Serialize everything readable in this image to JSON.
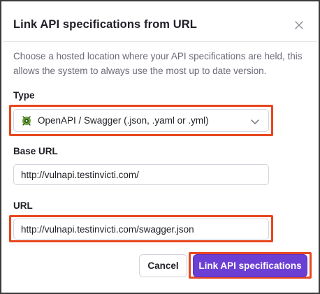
{
  "dialog": {
    "title": "Link API specifications from URL",
    "description": "Choose a hosted location where your API specifications are held, this allows the system to always use the most up to date version."
  },
  "type_field": {
    "label": "Type",
    "selected": "OpenAPI / Swagger (.json, .yaml or .yml)",
    "icon": "swagger-icon"
  },
  "base_url_field": {
    "label": "Base URL",
    "value": "http://vulnapi.testinvicti.com/"
  },
  "url_field": {
    "label": "URL",
    "value": "http://vulnapi.testinvicti.com/swagger.json"
  },
  "actions": {
    "cancel_label": "Cancel",
    "link_label": "Link API specifications"
  },
  "colors": {
    "primary": "#6b3fd4",
    "highlight": "#e8461e",
    "swagger_green": "#6ba539"
  }
}
